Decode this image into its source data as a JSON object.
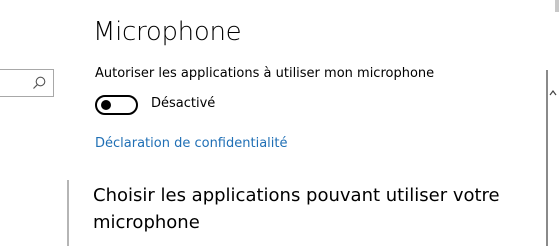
{
  "search": {
    "value": "",
    "placeholder": ""
  },
  "header": {
    "title": "Microphone"
  },
  "setting": {
    "label": "Autoriser les applications à utiliser mon microphone",
    "toggle_state_label": "Désactivé",
    "toggle_on": false
  },
  "links": {
    "privacy": "Déclaration de confidentialité"
  },
  "section": {
    "heading": "Choisir les applications pouvant utiliser votre microphone"
  },
  "colors": {
    "link": "#1f6fb5",
    "text": "#000000",
    "background": "#ffffff"
  },
  "icons": {
    "search": "search-icon",
    "toggle": "toggle-switch",
    "scroll": "chevron-up-icon"
  }
}
